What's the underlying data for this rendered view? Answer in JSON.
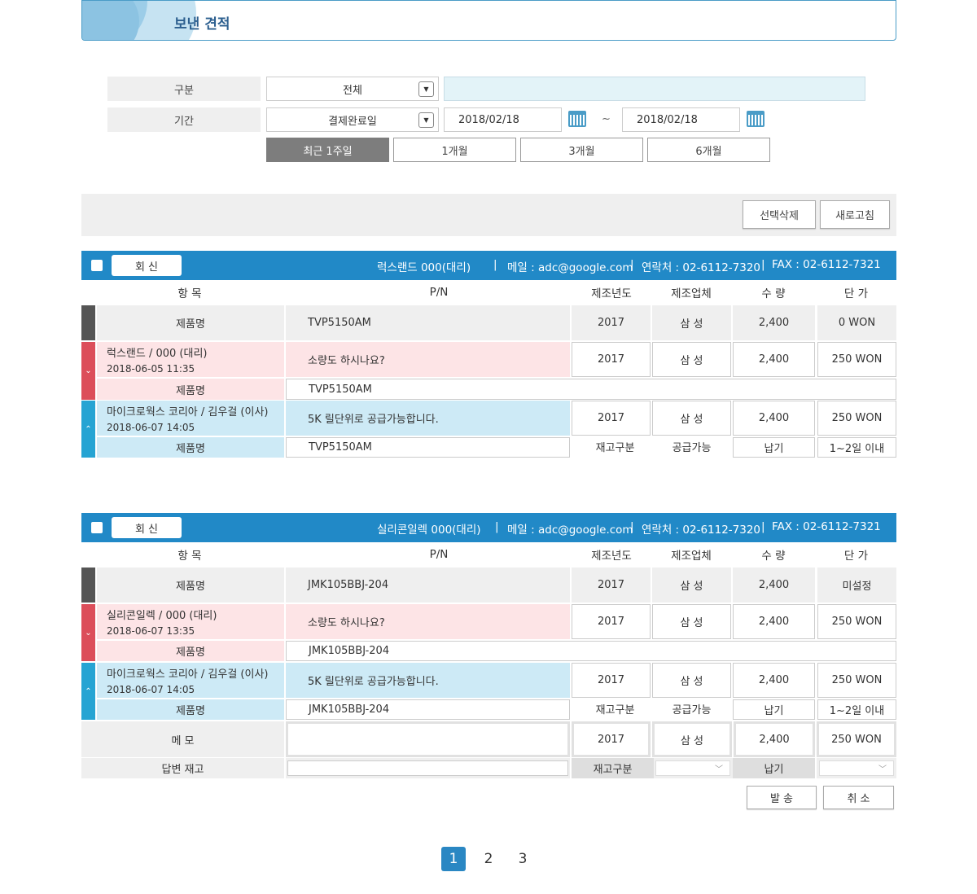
{
  "page_title": "보낸 견적",
  "search": {
    "category_label": "구분",
    "category_value": "전체",
    "period_label": "기간",
    "period_type_value": "결제완료일",
    "date_from": "2018/02/18",
    "date_sep": "~",
    "date_to": "2018/02/18",
    "period_buttons": [
      "최근 1주일",
      "1개월",
      "3개월",
      "6개월"
    ],
    "active_period": "최근 1주일"
  },
  "toolbar": {
    "delete_label": "선택삭제",
    "refresh_label": "새로고침"
  },
  "columns": {
    "item": "항 목",
    "pn": "P/N",
    "year": "제조년도",
    "maker": "제조업체",
    "qty": "수 량",
    "price": "단 가"
  },
  "reply_label": "회 신",
  "quotes": [
    {
      "header": {
        "company": "럭스랜드 000(대리)",
        "sep1": "|",
        "email": "메일 : adc@google.com",
        "sep2": "|",
        "phone": "연락처 : 02-6112-7320",
        "sep3": "|",
        "fax": "FAX : 02-6112-7321"
      },
      "product_row": {
        "label": "제품명",
        "pn": "TVP5150AM",
        "year": "2017",
        "maker": "삼 성",
        "qty": "2,400",
        "price": "0 WON"
      },
      "buyer_reply": {
        "name": "럭스랜드 / 000 (대리)",
        "datetime": "2018-06-05 11:35",
        "message": "소량도 하시나요?",
        "year": "2017",
        "maker": "삼 성",
        "qty": "2,400",
        "price": "250 WON",
        "sub_label": "제품명",
        "sub_pn": "TVP5150AM"
      },
      "seller_reply": {
        "name": "마이크로웍스 코리아 / 김우걸 (이사)",
        "datetime": "2018-06-07 14:05",
        "message": "5K 릴단위로 공급가능합니다.",
        "year": "2017",
        "maker": "삼 성",
        "qty": "2,400",
        "price": "250 WON",
        "sub_label": "제품명",
        "sub_pn": "TVP5150AM",
        "stock_label": "재고구분",
        "stock_value": "공급가능",
        "delivery_label": "납기",
        "delivery_value": "1~2일 이내"
      }
    },
    {
      "header": {
        "company": "실리콘일렉 000(대리)",
        "sep1": "|",
        "email": "메일 : adc@google.com",
        "sep2": "|",
        "phone": "연락처 : 02-6112-7320",
        "sep3": "|",
        "fax": "FAX : 02-6112-7321"
      },
      "product_row": {
        "label": "제품명",
        "pn": "JMK105BBJ-204",
        "year": "2017",
        "maker": "삼 성",
        "qty": "2,400",
        "price": "미설정"
      },
      "buyer_reply": {
        "name": "실리콘일렉 / 000 (대리)",
        "datetime": "2018-06-07 13:35",
        "message": "소량도 하시나요?",
        "year": "2017",
        "maker": "삼 성",
        "qty": "2,400",
        "price": "250 WON",
        "sub_label": "제품명",
        "sub_pn": "JMK105BBJ-204"
      },
      "seller_reply": {
        "name": "마이크로웍스 코리아 / 김우걸 (이사)",
        "datetime": "2018-06-07 14:05",
        "message": "5K 릴단위로 공급가능합니다.",
        "year": "2017",
        "maker": "삼 성",
        "qty": "2,400",
        "price": "250 WON",
        "sub_label": "제품명",
        "sub_pn": "JMK105BBJ-204",
        "stock_label": "재고구분",
        "stock_value": "공급가능",
        "delivery_label": "납기",
        "delivery_value": "1~2일 이내"
      },
      "memo": {
        "label": "메 모",
        "value": "",
        "year": "2017",
        "maker": "삼 성",
        "qty": "2,400",
        "price": "250 WON"
      },
      "answer_stock": {
        "label": "답변 재고",
        "value": "",
        "stock_label": "재고구분",
        "delivery_label": "납기"
      },
      "actions": {
        "send_label": "발 송",
        "cancel_label": "취 소"
      }
    }
  ],
  "pagination": {
    "pages": [
      "1",
      "2",
      "3"
    ],
    "current": "1"
  },
  "colors": {
    "primary": "#2189c7",
    "buyer_accent": "#dc4e5a",
    "seller_accent": "#26a4d3",
    "buyer_bg": "#fde4e6",
    "seller_bg": "#cdeaf6"
  }
}
